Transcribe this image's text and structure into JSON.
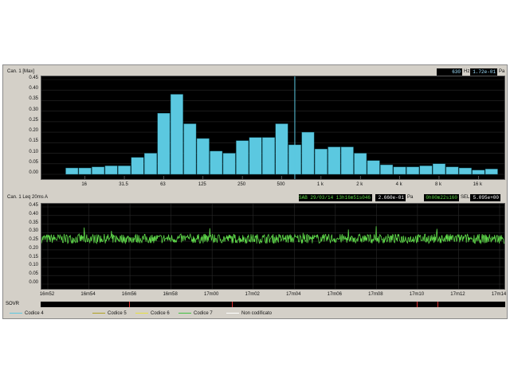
{
  "spectrum": {
    "channel_label": "Can. 1 [Max]",
    "freq_value": "630",
    "freq_unit": "Hz",
    "level_value": "1.72e-01",
    "level_unit": "Pa",
    "y_ticks": [
      "0.45",
      "0.40",
      "0.35",
      "0.30",
      "0.25",
      "0.20",
      "0.15",
      "0.10",
      "0.05",
      "0.00"
    ],
    "x_ticks": [
      "16",
      "31.5",
      "63",
      "125",
      "250",
      "500",
      "1 k",
      "2 k",
      "4 k",
      "8 k",
      "16 k"
    ]
  },
  "time": {
    "channel_label": "Can. 1 Leq 20ms A",
    "date_value": "SAB 29/03/14 13h16m51s046",
    "pa_value": "2.660e-01",
    "pa_unit": "Pa",
    "duration_value": "0h00m22s160",
    "sel_label": "SEL",
    "sel_value": "5.095e+00",
    "y_ticks": [
      "0.45",
      "0.40",
      "0.35",
      "0.30",
      "0.25",
      "0.20",
      "0.15",
      "0.10",
      "0.05",
      "0.00"
    ],
    "x_ticks": [
      "16m52",
      "16m54",
      "16m56",
      "16m58",
      "17m00",
      "17m02",
      "17m04",
      "17m06",
      "17m08",
      "17m10",
      "17m12",
      "17m14"
    ]
  },
  "sovr_label": "SOVR",
  "legend": [
    {
      "label": "Codice 4",
      "color": "#5bc8e0"
    },
    {
      "label": "Codice 5",
      "color": "#b0a020"
    },
    {
      "label": "Codice 6",
      "color": "#e8e040"
    },
    {
      "label": "Codice 7",
      "color": "#40c040"
    },
    {
      "label": "Non codificato",
      "color": "#ffffff"
    }
  ],
  "chart_data": [
    {
      "type": "bar",
      "ylim": [
        0,
        0.45
      ],
      "categories": [
        "12.5",
        "16",
        "20",
        "25",
        "31.5",
        "40",
        "50",
        "63",
        "80",
        "100",
        "125",
        "160",
        "200",
        "250",
        "315",
        "400",
        "500",
        "630",
        "800",
        "1 k",
        "1.25 k",
        "1.6 k",
        "2 k",
        "2.5 k",
        "3.15 k",
        "4 k",
        "5 k",
        "6.3 k",
        "8 k",
        "10 k",
        "12.5 k",
        "16 k",
        "20 k"
      ],
      "values": [
        0.03,
        0.03,
        0.035,
        0.04,
        0.04,
        0.08,
        0.1,
        0.29,
        0.38,
        0.24,
        0.17,
        0.11,
        0.1,
        0.16,
        0.175,
        0.175,
        0.24,
        0.14,
        0.2,
        0.12,
        0.13,
        0.13,
        0.1,
        0.065,
        0.045,
        0.035,
        0.035,
        0.04,
        0.05,
        0.035,
        0.03,
        0.02,
        0.025
      ],
      "bar_color": "#5bc8e0",
      "cursor": "630"
    },
    {
      "type": "line",
      "ylim": [
        0,
        0.45
      ],
      "x_start": "16m51",
      "x_end": "17m14",
      "mean_level": 0.265,
      "line_color": "#5fd84a",
      "sovr_marks": [
        "16m56",
        "17m01",
        "17m10",
        "17m11"
      ]
    }
  ]
}
